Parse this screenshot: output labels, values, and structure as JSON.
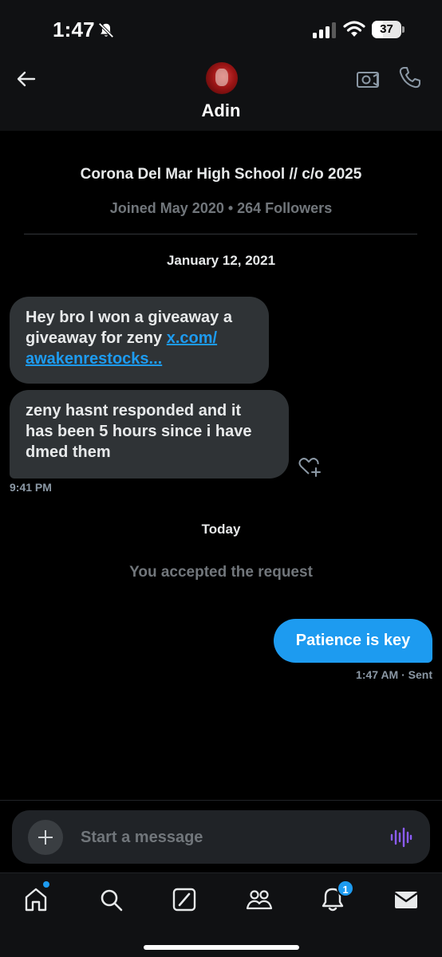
{
  "status_bar": {
    "time": "1:47",
    "battery": "37",
    "battery_fraction": 0.37,
    "icons": [
      "bell-off-icon",
      "signal-icon",
      "wifi-icon",
      "battery-icon"
    ]
  },
  "header": {
    "contact_name": "Adin",
    "icons": [
      "back-arrow-icon",
      "video-call-icon",
      "phone-icon"
    ]
  },
  "profile": {
    "bio": "Corona Del Mar High School // c/o 2025",
    "joined": "Joined May 2020 • 264 Followers"
  },
  "conversation": {
    "date_label": "January 12, 2021",
    "messages_in": [
      {
        "text_before": "Hey bro I won a giveaway a giveaway for zeny ",
        "link": "x.com/\nawakenrestocks..."
      },
      {
        "text": "zeny hasnt responded and it has been 5 hours since i have dmed them"
      }
    ],
    "incoming_time": "9:41 PM",
    "today_label": "Today",
    "system_message": "You accepted the request",
    "message_out": "Patience is key",
    "sent_meta": "1:47 AM · Sent"
  },
  "composer": {
    "placeholder": "Start a message"
  },
  "tab_bar": {
    "items": [
      "home-icon",
      "search-icon",
      "grok-icon",
      "communities-icon",
      "notifications-icon",
      "messages-icon"
    ],
    "notifications_badge": "1"
  },
  "colors": {
    "accent": "#1d9bf0",
    "bubble_in": "#2f3336",
    "muted": "#71767b",
    "voice": "#8b5cf6"
  }
}
